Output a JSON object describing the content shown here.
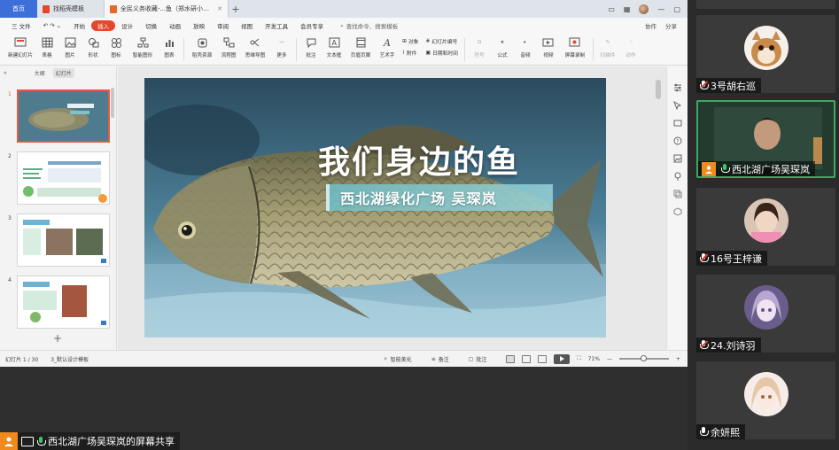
{
  "wps": {
    "tabs": [
      {
        "label": "首页"
      },
      {
        "label": "找稻壳模板"
      },
      {
        "label": "全民义务收藏-...鱼（郑水研小学）"
      }
    ],
    "menu": [
      "三 文件",
      "开始",
      "插入",
      "设计",
      "切换",
      "动画",
      "放映",
      "审阅",
      "视图",
      "开发工具",
      "会员专享"
    ],
    "menu_highlight": "插入",
    "search_label": "查找命令、搜索模板",
    "menu_right": [
      "协作",
      "分享"
    ],
    "ribbon": {
      "new_slide": "新建幻灯片",
      "table": "表格",
      "picture": "图片",
      "shape": "形状",
      "icon": "图标",
      "smart_graphic": "智能图形",
      "chart": "图表",
      "stock_material": "稻壳资源",
      "flowchart": "流程图",
      "mindmap": "思维导图",
      "more": "更多",
      "comment": "批注",
      "textbox": "文本框",
      "header_footer": "页眉页脚",
      "art_text": "艺术字",
      "object": "对象",
      "attachment": "附件",
      "slide_number": "幻灯片编号",
      "date_time": "日期和时间",
      "symbol": "符号",
      "formula": "公式",
      "audio": "音频",
      "video": "视频",
      "screen_record": "屏幕录制",
      "signature": "扫描件",
      "action": "动作"
    },
    "left_pane": {
      "tab_outline": "大纲",
      "tab_slides": "幻灯片",
      "slide_numbers": [
        "1",
        "2",
        "3",
        "4"
      ]
    },
    "slide": {
      "title": "我们身边的鱼",
      "subtitle": "西北湖绿化广场  吴琛岚"
    },
    "status": {
      "slide_pos": "幻灯片 1 / 30",
      "theme": "3_默认设计模板",
      "smart_beautify": "智能美化",
      "notes": "备注",
      "comments": "批注",
      "zoom": "71%"
    }
  },
  "meeting": {
    "share_label": "西北湖广场吴琛岚的屏幕共享",
    "participants": [
      {
        "name": "3号胡右巡",
        "mic": "muted",
        "host": false
      },
      {
        "name": "西北湖广场吴琛岚",
        "mic": "on",
        "host": true
      },
      {
        "name": "16号王梓谦",
        "mic": "muted",
        "host": false
      },
      {
        "name": "24.刘诗羽",
        "mic": "muted",
        "host": false
      },
      {
        "name": "余妍熙",
        "mic": "on",
        "host": false
      }
    ]
  },
  "colors": {
    "accent_red": "#e8452f",
    "host_orange": "#f08a1c",
    "active_green": "#3ea862"
  }
}
